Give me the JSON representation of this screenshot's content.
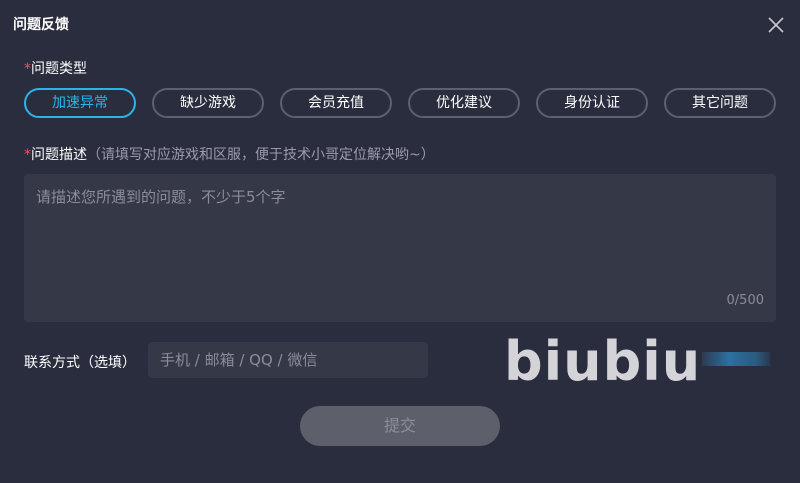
{
  "dialog": {
    "title": "问题反馈"
  },
  "problem_type": {
    "required_mark": "*",
    "label": "问题类型",
    "options": [
      {
        "label": "加速异常",
        "selected": true
      },
      {
        "label": "缺少游戏",
        "selected": false
      },
      {
        "label": "会员充值",
        "selected": false
      },
      {
        "label": "优化建议",
        "selected": false
      },
      {
        "label": "身份认证",
        "selected": false
      },
      {
        "label": "其它问题",
        "selected": false
      }
    ]
  },
  "description": {
    "required_mark": "*",
    "label": "问题描述",
    "hint": "（请填写对应游戏和区服，便于技术小哥定位解决哟~）",
    "placeholder": "请描述您所遇到的问题，不少于5个字",
    "value": "",
    "counter": "0/500"
  },
  "contact": {
    "label": "联系方式（选填）",
    "placeholder": "手机 / 邮箱 / QQ / 微信",
    "value": ""
  },
  "watermark": {
    "text": "biubiu"
  },
  "submit": {
    "label": "提交"
  },
  "colors": {
    "background": "#2a2d3e",
    "accent": "#2bb4ea",
    "required": "#ff4d4f",
    "input_bg": "#353847"
  }
}
